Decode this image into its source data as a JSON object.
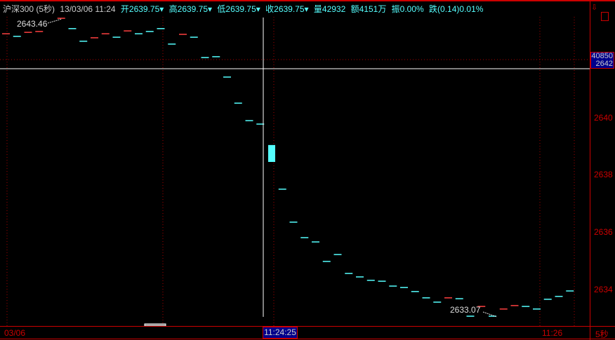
{
  "header": {
    "symbol": "沪深300 (5秒)",
    "date": "13/03/06 11:24",
    "open": "开2639.75▾",
    "high": "高2639.75▾",
    "low": "低2639.75▾",
    "close": "收2639.75▾",
    "volume": "量42932",
    "amount": "额4151万",
    "amplitude": "振0.00%",
    "change": "跌(0.14)0.01%"
  },
  "axis": {
    "price_labels": [
      "2640",
      "2638",
      "2636",
      "2634"
    ],
    "cursor_volume": "40850",
    "cursor_price": "2642",
    "time_start": "03/06",
    "time_cursor": "11:24:25",
    "time_end": "11:26",
    "period": "5秒"
  },
  "annotations": {
    "high": "2643.46",
    "low": "2633.07"
  },
  "icons": [
    "download-icon",
    "panel-toggle-icon"
  ],
  "colors": {
    "up": "#ff4040",
    "down": "#55ffff",
    "axis": "#cc0000"
  },
  "chart_data": {
    "type": "candlestick",
    "price_range": [
      2633,
      2644
    ],
    "bars": [
      {
        "p": 2642.92,
        "c": "up"
      },
      {
        "p": 2642.83,
        "c": "down"
      },
      {
        "p": 2642.97,
        "c": "up"
      },
      {
        "p": 2643.0,
        "c": "up"
      },
      {
        "p": null
      },
      {
        "p": 2643.46,
        "c": "up"
      },
      {
        "p": 2643.1,
        "c": "down"
      },
      {
        "p": 2642.66,
        "c": "down"
      },
      {
        "p": 2642.78,
        "c": "up"
      },
      {
        "p": 2642.92,
        "c": "up"
      },
      {
        "p": 2642.8,
        "c": "down"
      },
      {
        "p": 2643.02,
        "c": "up"
      },
      {
        "p": 2642.92,
        "c": "down"
      },
      {
        "p": 2643.0,
        "c": "down"
      },
      {
        "p": 2643.1,
        "c": "down"
      },
      {
        "p": 2642.56,
        "c": "down"
      },
      {
        "p": 2642.9,
        "c": "up"
      },
      {
        "p": 2642.8,
        "c": "down"
      },
      {
        "p": 2642.09,
        "c": "down"
      },
      {
        "p": 2642.12,
        "c": "down"
      },
      {
        "p": 2641.41,
        "c": "down"
      },
      {
        "p": 2640.5,
        "c": "down"
      },
      {
        "p": 2639.89,
        "c": "down"
      },
      {
        "p": 2639.77,
        "c": "down"
      },
      {
        "o": 2639.04,
        "cl": 2638.45,
        "c": "down"
      },
      {
        "p": 2637.5,
        "c": "down"
      },
      {
        "p": 2636.35,
        "c": "down"
      },
      {
        "p": 2635.81,
        "c": "down"
      },
      {
        "p": 2635.66,
        "c": "down"
      },
      {
        "p": 2634.98,
        "c": "down"
      },
      {
        "p": 2635.22,
        "c": "down"
      },
      {
        "p": 2634.56,
        "c": "down"
      },
      {
        "p": 2634.44,
        "c": "down"
      },
      {
        "p": 2634.32,
        "c": "down"
      },
      {
        "p": 2634.29,
        "c": "down"
      },
      {
        "p": 2634.12,
        "c": "down"
      },
      {
        "p": 2634.07,
        "c": "down"
      },
      {
        "p": 2633.93,
        "c": "down"
      },
      {
        "p": 2633.71,
        "c": "down"
      },
      {
        "p": 2633.56,
        "c": "down"
      },
      {
        "p": 2633.71,
        "c": "up"
      },
      {
        "p": 2633.68,
        "c": "down"
      },
      {
        "p": 2633.07,
        "c": "down"
      },
      {
        "p": 2633.41,
        "c": "up"
      },
      {
        "p": 2633.07,
        "c": "down"
      },
      {
        "p": 2633.32,
        "c": "up"
      },
      {
        "p": 2633.44,
        "c": "up"
      },
      {
        "p": 2633.41,
        "c": "down"
      },
      {
        "p": 2633.32,
        "c": "down"
      },
      {
        "p": 2633.66,
        "c": "down"
      },
      {
        "p": 2633.76,
        "c": "down"
      },
      {
        "p": 2633.95,
        "c": "down"
      }
    ]
  }
}
